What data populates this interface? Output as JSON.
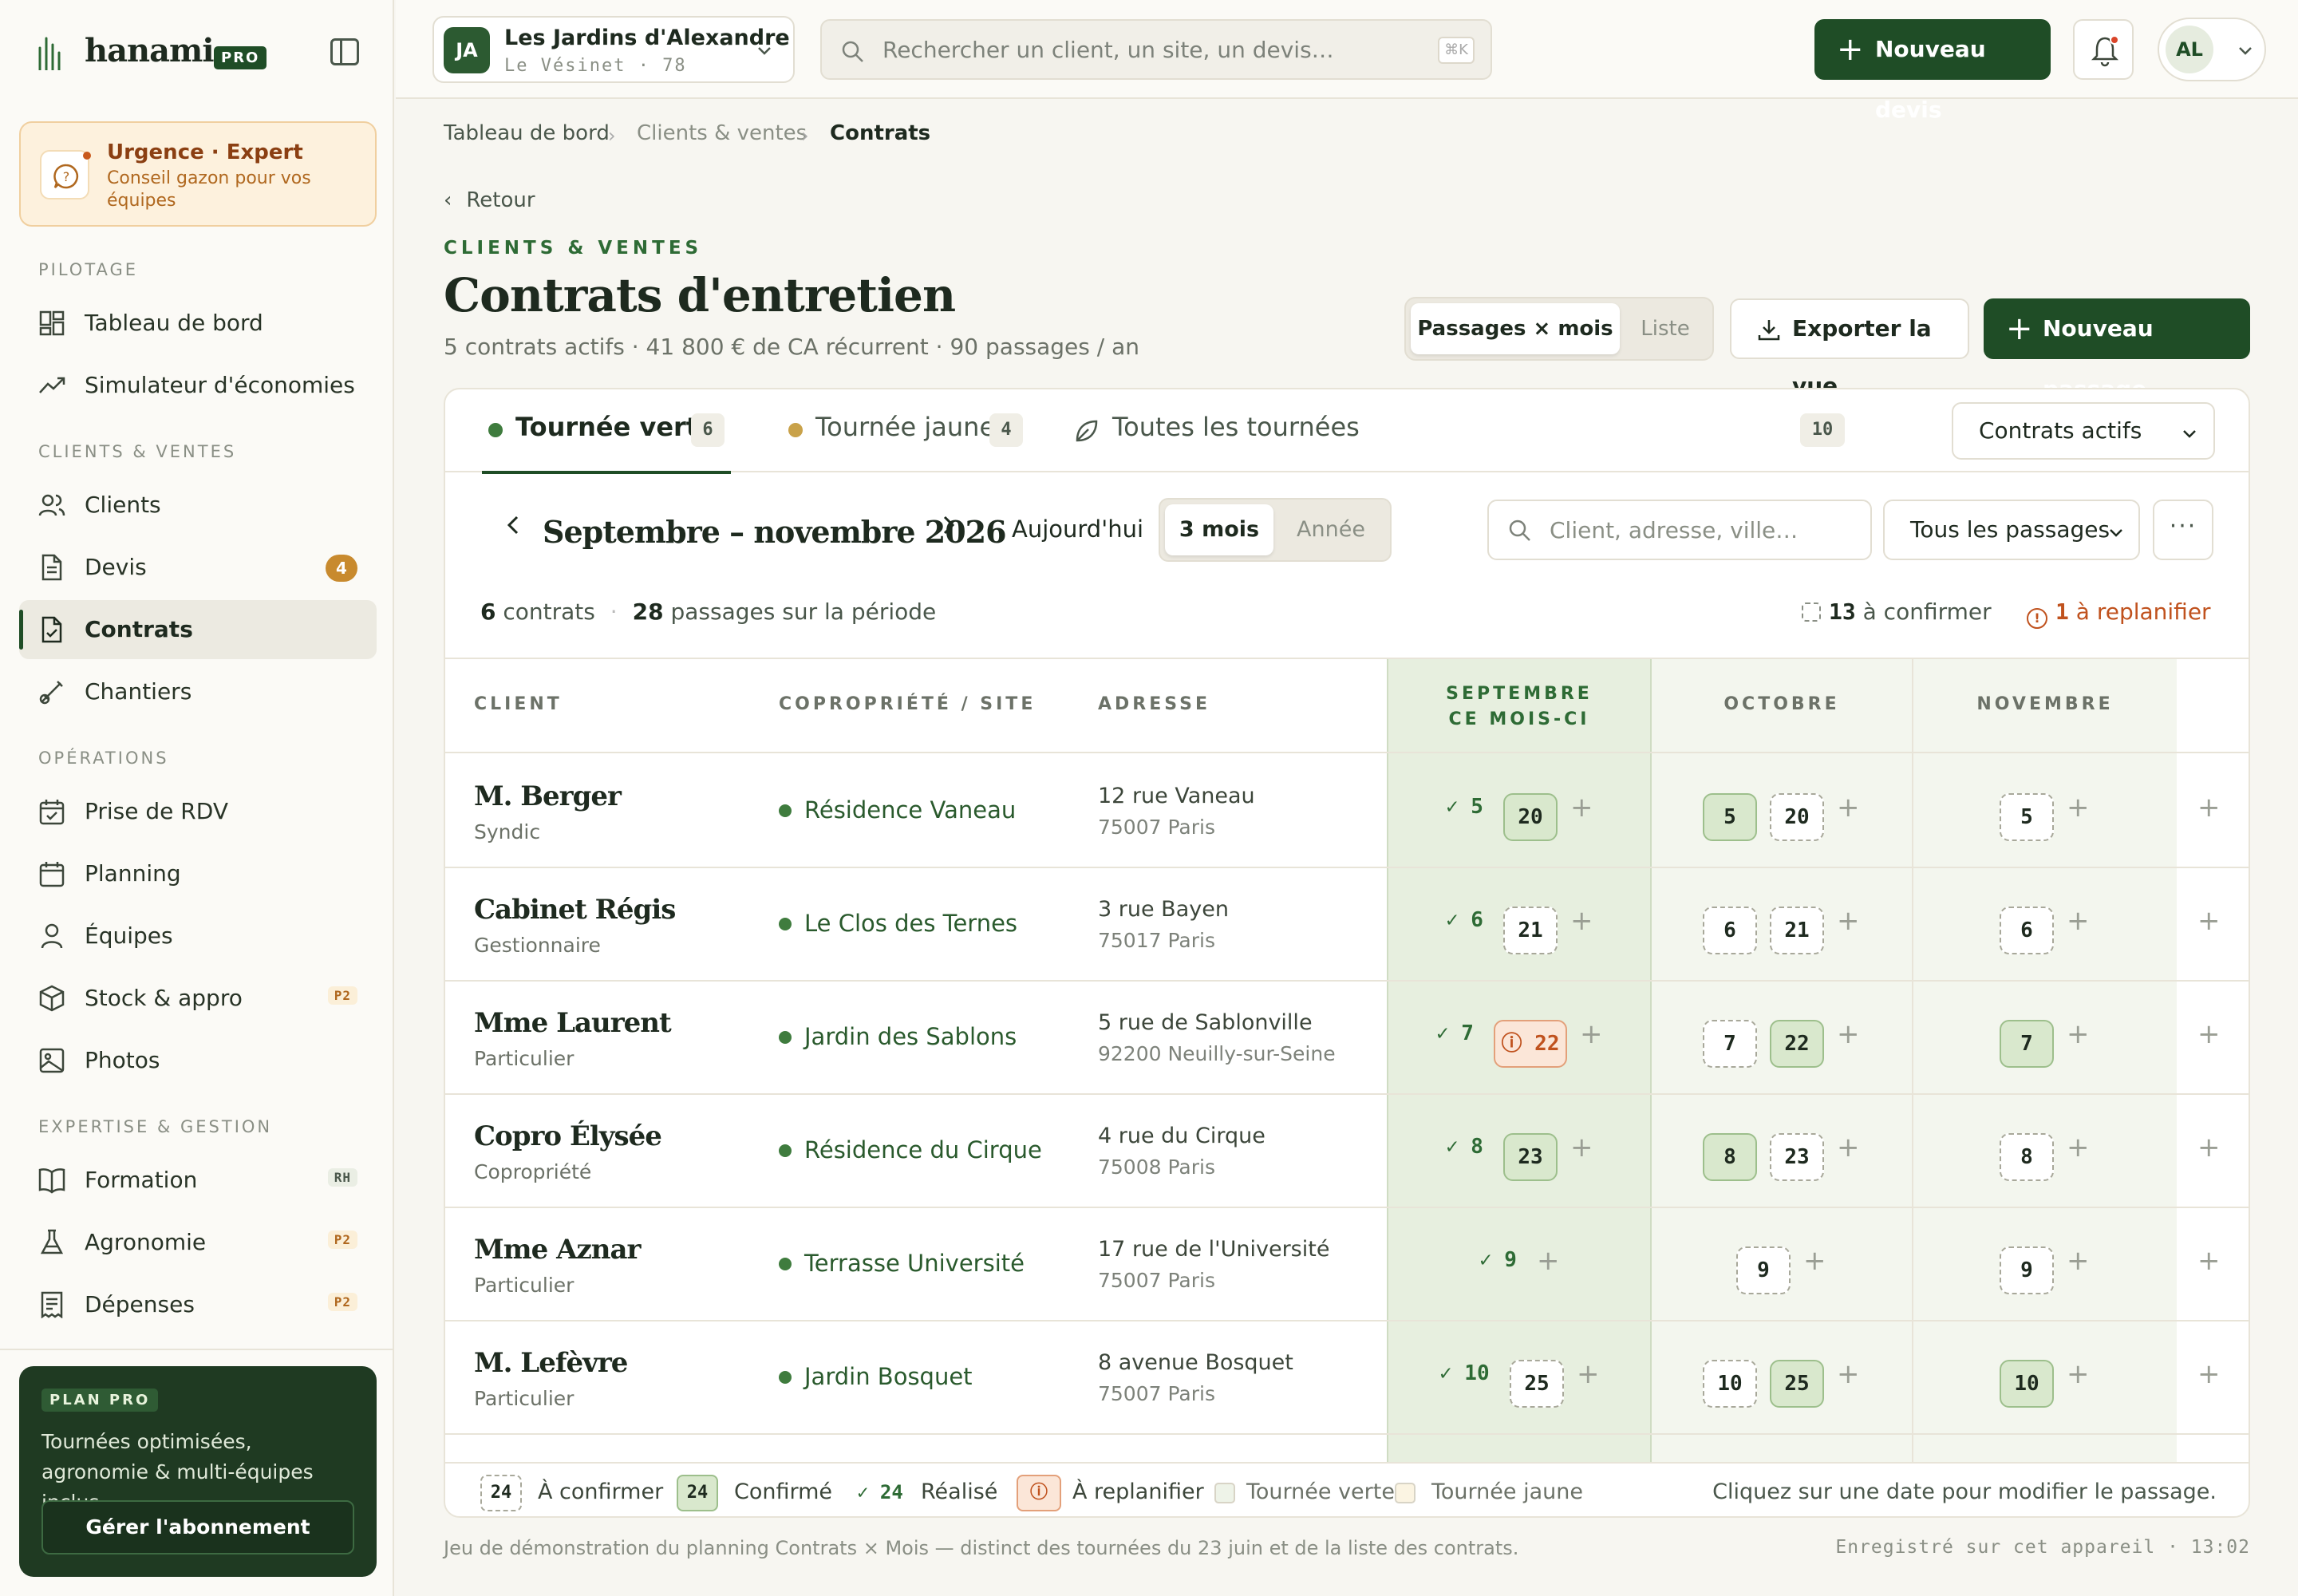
{
  "app": {
    "name": "hanami.",
    "badge": "PRO"
  },
  "urgence": {
    "title": "Urgence · Expert",
    "text": "Conseil gazon pour vos équipes"
  },
  "sidebar": {
    "sections": [
      "PILOTAGE",
      "CLIENTS & VENTES",
      "OPÉRATIONS",
      "EXPERTISE & GESTION"
    ],
    "items": [
      {
        "label": "Tableau de bord"
      },
      {
        "label": "Simulateur d'économies"
      },
      {
        "label": "Clients"
      },
      {
        "label": "Devis",
        "count": "4"
      },
      {
        "label": "Contrats"
      },
      {
        "label": "Chantiers"
      },
      {
        "label": "Prise de RDV"
      },
      {
        "label": "Planning"
      },
      {
        "label": "Équipes"
      },
      {
        "label": "Stock & appro",
        "tag": "P2"
      },
      {
        "label": "Photos"
      },
      {
        "label": "Formation",
        "tag": "RH"
      },
      {
        "label": "Agronomie",
        "tag": "P2"
      },
      {
        "label": "Dépenses",
        "tag": "P2"
      }
    ]
  },
  "plan": {
    "badge": "PLAN PRO",
    "text": "Tournées optimisées, agronomie & multi-équipes inclus.",
    "button": "Gérer l'abonnement"
  },
  "org": {
    "initials": "JA",
    "name": "Les Jardins d'Alexandre",
    "sub": "Le Vésinet · 78"
  },
  "search": {
    "placeholder": "Rechercher un client, un site, un devis…",
    "kbd": "⌘K"
  },
  "topbar": {
    "new_devis": "Nouveau devis",
    "user_initials": "AL"
  },
  "breadcrumb": [
    "Tableau de bord",
    "Clients & ventes",
    "Contrats"
  ],
  "page": {
    "back": "Retour",
    "eyebrow": "CLIENTS & VENTES",
    "title": "Contrats d'entretien",
    "subtitle": "5 contrats actifs · 41 800 € de CA récurrent · 90 passages / an",
    "view_on": "Passages × mois",
    "view_off": "Liste",
    "export": "Exporter la vue",
    "new_passage": "Nouveau passage"
  },
  "tabs": [
    {
      "label": "Tournée verte",
      "count": "6",
      "color": "#3f7c3e"
    },
    {
      "label": "Tournée jaune",
      "count": "4",
      "color": "#c9a24a"
    },
    {
      "label": "Toutes les tournées",
      "count": "10"
    }
  ],
  "contract_filter": "Contrats actifs",
  "period": {
    "label": "Septembre – novembre 2026",
    "today": "Aujourd'hui",
    "range_on": "3 mois",
    "range_off": "Année"
  },
  "client_search": {
    "placeholder": "Client, adresse, ville…"
  },
  "passage_filter": "Tous les passages",
  "stats": {
    "contracts": "6",
    "contracts_label": "contrats",
    "passages": "28",
    "passages_label": "passages sur la période",
    "to_confirm": "13",
    "to_confirm_label": "à confirmer",
    "replan": "1",
    "replan_label": "à replanifier"
  },
  "table": {
    "headers": [
      "CLIENT",
      "COPROPRIÉTÉ / SITE",
      "ADRESSE"
    ],
    "months": [
      {
        "label": "SEPTEMBRE",
        "sub": "CE MOIS-CI"
      },
      {
        "label": "OCTOBRE"
      },
      {
        "label": "NOVEMBRE"
      }
    ],
    "rows": [
      {
        "client": "M. Berger",
        "role": "Syndic",
        "site": "Résidence Vaneau",
        "addr1": "12 rue Vaneau",
        "addr2": "75007 Paris",
        "sep": [
          {
            "v": "5",
            "s": "done"
          },
          {
            "v": "20",
            "s": "conf"
          }
        ],
        "oct": [
          {
            "v": "5",
            "s": "conf"
          },
          {
            "v": "20",
            "s": "dash"
          }
        ],
        "nov": [
          {
            "v": "5",
            "s": "dash"
          }
        ]
      },
      {
        "client": "Cabinet Régis",
        "role": "Gestionnaire",
        "site": "Le Clos des Ternes",
        "addr1": "3 rue Bayen",
        "addr2": "75017 Paris",
        "sep": [
          {
            "v": "6",
            "s": "done"
          },
          {
            "v": "21",
            "s": "dash"
          }
        ],
        "oct": [
          {
            "v": "6",
            "s": "dash"
          },
          {
            "v": "21",
            "s": "dash"
          }
        ],
        "nov": [
          {
            "v": "6",
            "s": "dash"
          }
        ]
      },
      {
        "client": "Mme Laurent",
        "role": "Particulier",
        "site": "Jardin des Sablons",
        "addr1": "5 rue de Sablonville",
        "addr2": "92200 Neuilly-sur-Seine",
        "sep": [
          {
            "v": "7",
            "s": "done"
          },
          {
            "v": "22",
            "s": "repl"
          }
        ],
        "oct": [
          {
            "v": "7",
            "s": "dash"
          },
          {
            "v": "22",
            "s": "conf"
          }
        ],
        "nov": [
          {
            "v": "7",
            "s": "conf"
          }
        ]
      },
      {
        "client": "Copro Élysée",
        "role": "Copropriété",
        "site": "Résidence du Cirque",
        "addr1": "4 rue du Cirque",
        "addr2": "75008 Paris",
        "sep": [
          {
            "v": "8",
            "s": "done"
          },
          {
            "v": "23",
            "s": "conf"
          }
        ],
        "oct": [
          {
            "v": "8",
            "s": "conf"
          },
          {
            "v": "23",
            "s": "dash"
          }
        ],
        "nov": [
          {
            "v": "8",
            "s": "dash"
          }
        ]
      },
      {
        "client": "Mme Aznar",
        "role": "Particulier",
        "site": "Terrasse Université",
        "addr1": "17 rue de l'Université",
        "addr2": "75007 Paris",
        "sep": [
          {
            "v": "9",
            "s": "done"
          }
        ],
        "oct": [
          {
            "v": "9",
            "s": "dash"
          }
        ],
        "nov": [
          {
            "v": "9",
            "s": "dash"
          }
        ]
      },
      {
        "client": "M. Lefèvre",
        "role": "Particulier",
        "site": "Jardin Bosquet",
        "addr1": "8 avenue Bosquet",
        "addr2": "75007 Paris",
        "sep": [
          {
            "v": "10",
            "s": "done"
          },
          {
            "v": "25",
            "s": "dash"
          }
        ],
        "oct": [
          {
            "v": "10",
            "s": "dash"
          },
          {
            "v": "25",
            "s": "conf"
          }
        ],
        "nov": [
          {
            "v": "10",
            "s": "conf"
          }
        ]
      }
    ]
  },
  "legend": {
    "to_confirm": "À confirmer",
    "confirmed": "Confirmé",
    "done": "Réalisé",
    "replan": "À replanifier",
    "verte": "Tournée verte",
    "jaune": "Tournée jaune",
    "sample": "24",
    "done_sample": "✓ 24",
    "hint": "Cliquez sur une date pour modifier le passage."
  },
  "footer": {
    "left": "Jeu de démonstration du planning Contrats × Mois — distinct des tournées du 23 juin et de la liste des contrats.",
    "right": "Enregistré sur cet appareil · 13:02"
  }
}
